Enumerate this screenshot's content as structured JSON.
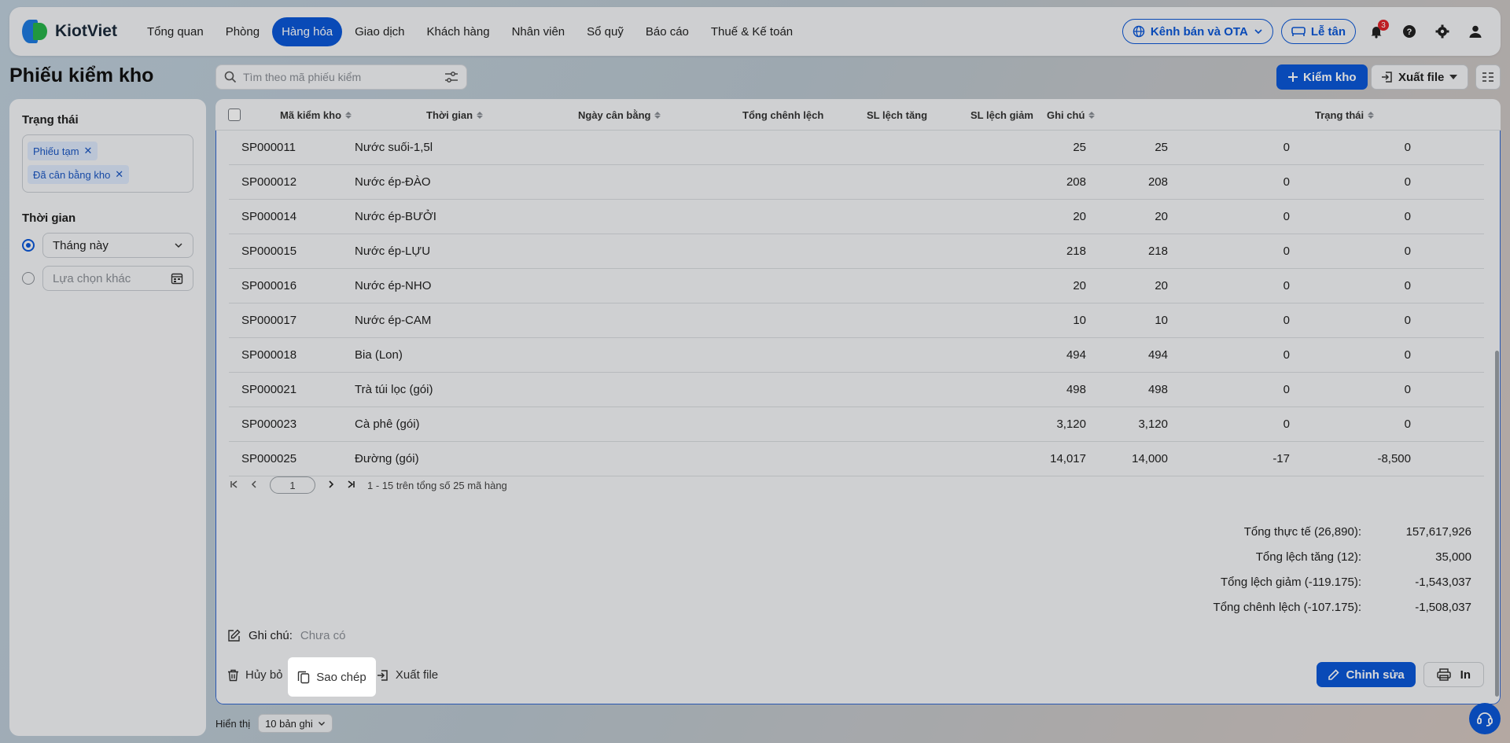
{
  "app": {
    "logo_text": "KiotViet"
  },
  "nav": {
    "items": [
      {
        "label": "Tổng quan"
      },
      {
        "label": "Phòng"
      },
      {
        "label": "Hàng hóa"
      },
      {
        "label": "Giao dịch"
      },
      {
        "label": "Khách hàng"
      },
      {
        "label": "Nhân viên"
      },
      {
        "label": "Sổ quỹ"
      },
      {
        "label": "Báo cáo"
      },
      {
        "label": "Thuế & Kế toán"
      }
    ],
    "active_index": 2,
    "channel_label": "Kênh bán và OTA",
    "reception_label": "Lễ tân",
    "notification_count": "3"
  },
  "page": {
    "title": "Phiếu kiểm kho",
    "search_placeholder": "Tìm theo mã phiếu kiểm",
    "add_button": "Kiểm kho",
    "export_button": "Xuất file"
  },
  "sidebar": {
    "status_heading": "Trạng thái",
    "status_tags": [
      "Phiếu tạm",
      "Đã cân bằng kho"
    ],
    "time_heading": "Thời gian",
    "time_selected": "Tháng này",
    "time_other_placeholder": "Lựa chọn khác"
  },
  "table": {
    "columns": [
      "Mã kiểm kho",
      "Thời gian",
      "Ngày cân bằng",
      "Tổng chênh lệch",
      "SL lệch tăng",
      "SL lệch giảm",
      "Ghi chú",
      "Trạng thái"
    ],
    "rows": [
      {
        "code": "SP000011",
        "name": "Nước suối-1,5l",
        "n1": "25",
        "n2": "25",
        "n3": "0",
        "n4": "0"
      },
      {
        "code": "SP000012",
        "name": "Nước ép-ĐÀO",
        "n1": "208",
        "n2": "208",
        "n3": "0",
        "n4": "0"
      },
      {
        "code": "SP000014",
        "name": "Nước ép-BƯỞI",
        "n1": "20",
        "n2": "20",
        "n3": "0",
        "n4": "0"
      },
      {
        "code": "SP000015",
        "name": "Nước ép-LỰU",
        "n1": "218",
        "n2": "218",
        "n3": "0",
        "n4": "0"
      },
      {
        "code": "SP000016",
        "name": "Nước ép-NHO",
        "n1": "20",
        "n2": "20",
        "n3": "0",
        "n4": "0"
      },
      {
        "code": "SP000017",
        "name": "Nước ép-CAM",
        "n1": "10",
        "n2": "10",
        "n3": "0",
        "n4": "0"
      },
      {
        "code": "SP000018",
        "name": "Bia (Lon)",
        "n1": "494",
        "n2": "494",
        "n3": "0",
        "n4": "0"
      },
      {
        "code": "SP000021",
        "name": "Trà túi lọc (gói)",
        "n1": "498",
        "n2": "498",
        "n3": "0",
        "n4": "0"
      },
      {
        "code": "SP000023",
        "name": "Cà phê (gói)",
        "n1": "3,120",
        "n2": "3,120",
        "n3": "0",
        "n4": "0"
      },
      {
        "code": "SP000025",
        "name": "Đường (gói)",
        "n1": "14,017",
        "n2": "14,000",
        "n3": "-17",
        "n4": "-8,500"
      }
    ],
    "pager": {
      "page": "1",
      "summary": "1 - 15 trên tổng số 25 mã hàng"
    }
  },
  "totals": [
    {
      "label": "Tổng thực tế (26,890):",
      "value": "157,617,926"
    },
    {
      "label": "Tổng lệch tăng (12):",
      "value": "35,000"
    },
    {
      "label": "Tổng lệch giảm (-119.175):",
      "value": "-1,543,037"
    },
    {
      "label": "Tổng chênh lệch (-107.175):",
      "value": "-1,508,037"
    }
  ],
  "note": {
    "label": "Ghi chú:",
    "value": "Chưa có"
  },
  "actions": {
    "cancel": "Hủy bỏ",
    "copy": "Sao chép",
    "export": "Xuất file",
    "edit": "Chỉnh sửa",
    "print": "In"
  },
  "footer": {
    "show_label": "Hiển thị",
    "per_page": "10 bản ghi"
  },
  "colors": {
    "primary": "#0b57d8",
    "badge": "#e0242a",
    "tag_bg": "#dce8fb"
  }
}
